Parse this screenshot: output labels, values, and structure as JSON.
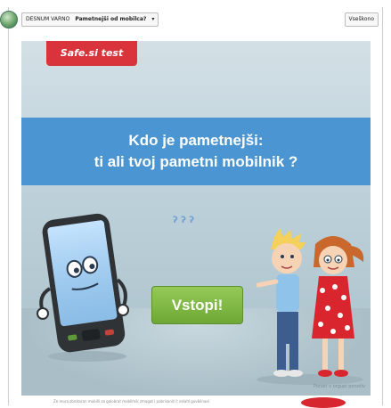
{
  "toolbar": {
    "section": "DESNUM VARNO",
    "selected": "Pametnejši od mobilca?",
    "right_button": "Vseškono"
  },
  "game": {
    "brand_tag": "Safe.si test",
    "question_line1": "Kdo je pametnejši:",
    "question_line2": "ti ali tvoj pametni mobilnik ?",
    "start_button": "Vstopi!",
    "credit": "Ponori v orgupi ponotiv"
  },
  "footer": {
    "text": "Ze mora zbrotaran mobilli za golobrat moblimik zmagat i pobrisaniti t nelahl govbilnaei"
  },
  "colors": {
    "banner": "#4b95d3",
    "brand_tag": "#d9343c",
    "start_button": "#7fb444",
    "stage_bg": "#bcd0d9"
  },
  "icons": [
    "app-logo-icon",
    "chevron-down-icon",
    "phone-character",
    "kids-characters"
  ]
}
